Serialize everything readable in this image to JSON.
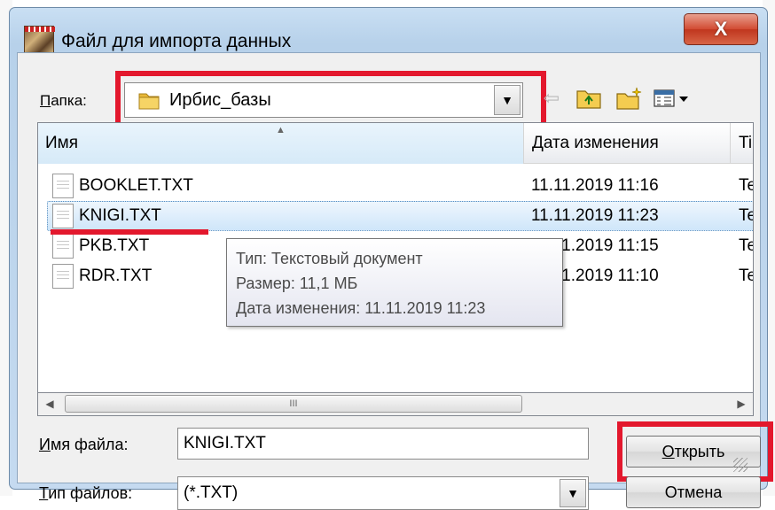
{
  "window": {
    "title": "Файл для импорта данных",
    "close_label": "X"
  },
  "folder": {
    "label_underlined": "П",
    "label_rest": "апка:",
    "value": "Ирбис_базы"
  },
  "list": {
    "columns": [
      "Имя",
      "Дата изменения",
      "Ti"
    ],
    "rows": [
      {
        "name": "BOOKLET.TXT",
        "date": "11.11.2019 11:16",
        "type": "Te"
      },
      {
        "name": "KNIGI.TXT",
        "date": "11.11.2019 11:23",
        "type": "Te"
      },
      {
        "name": "PKB.TXT",
        "date": "11.11.2019 11:15",
        "type": "Te"
      },
      {
        "name": "RDR.TXT",
        "date": "11.11.2019 11:10",
        "type": "Te"
      }
    ],
    "selected_index": 1
  },
  "tooltip": {
    "line1": "Тип: Текстовый документ",
    "line2": "Размер: 11,1 МБ",
    "line3": "Дата изменения: 11.11.2019 11:23"
  },
  "scrollbar": {
    "thumb_grip": "III"
  },
  "filename": {
    "label_underlined": "И",
    "label_rest": "мя файла:",
    "value": "KNIGI.TXT"
  },
  "filetype": {
    "label_underlined": "Т",
    "label_rest": "ип файлов:",
    "value": "(*.TXT)"
  },
  "buttons": {
    "open_underlined": "О",
    "open_rest": "ткрыть",
    "cancel": "Отмена"
  },
  "icons": {
    "back": "back-arrow-icon",
    "up": "folder-up-icon",
    "new": "new-folder-icon",
    "view": "view-menu-icon"
  },
  "colors": {
    "highlight": "#e3182d",
    "selection": "#cfe6fa"
  }
}
